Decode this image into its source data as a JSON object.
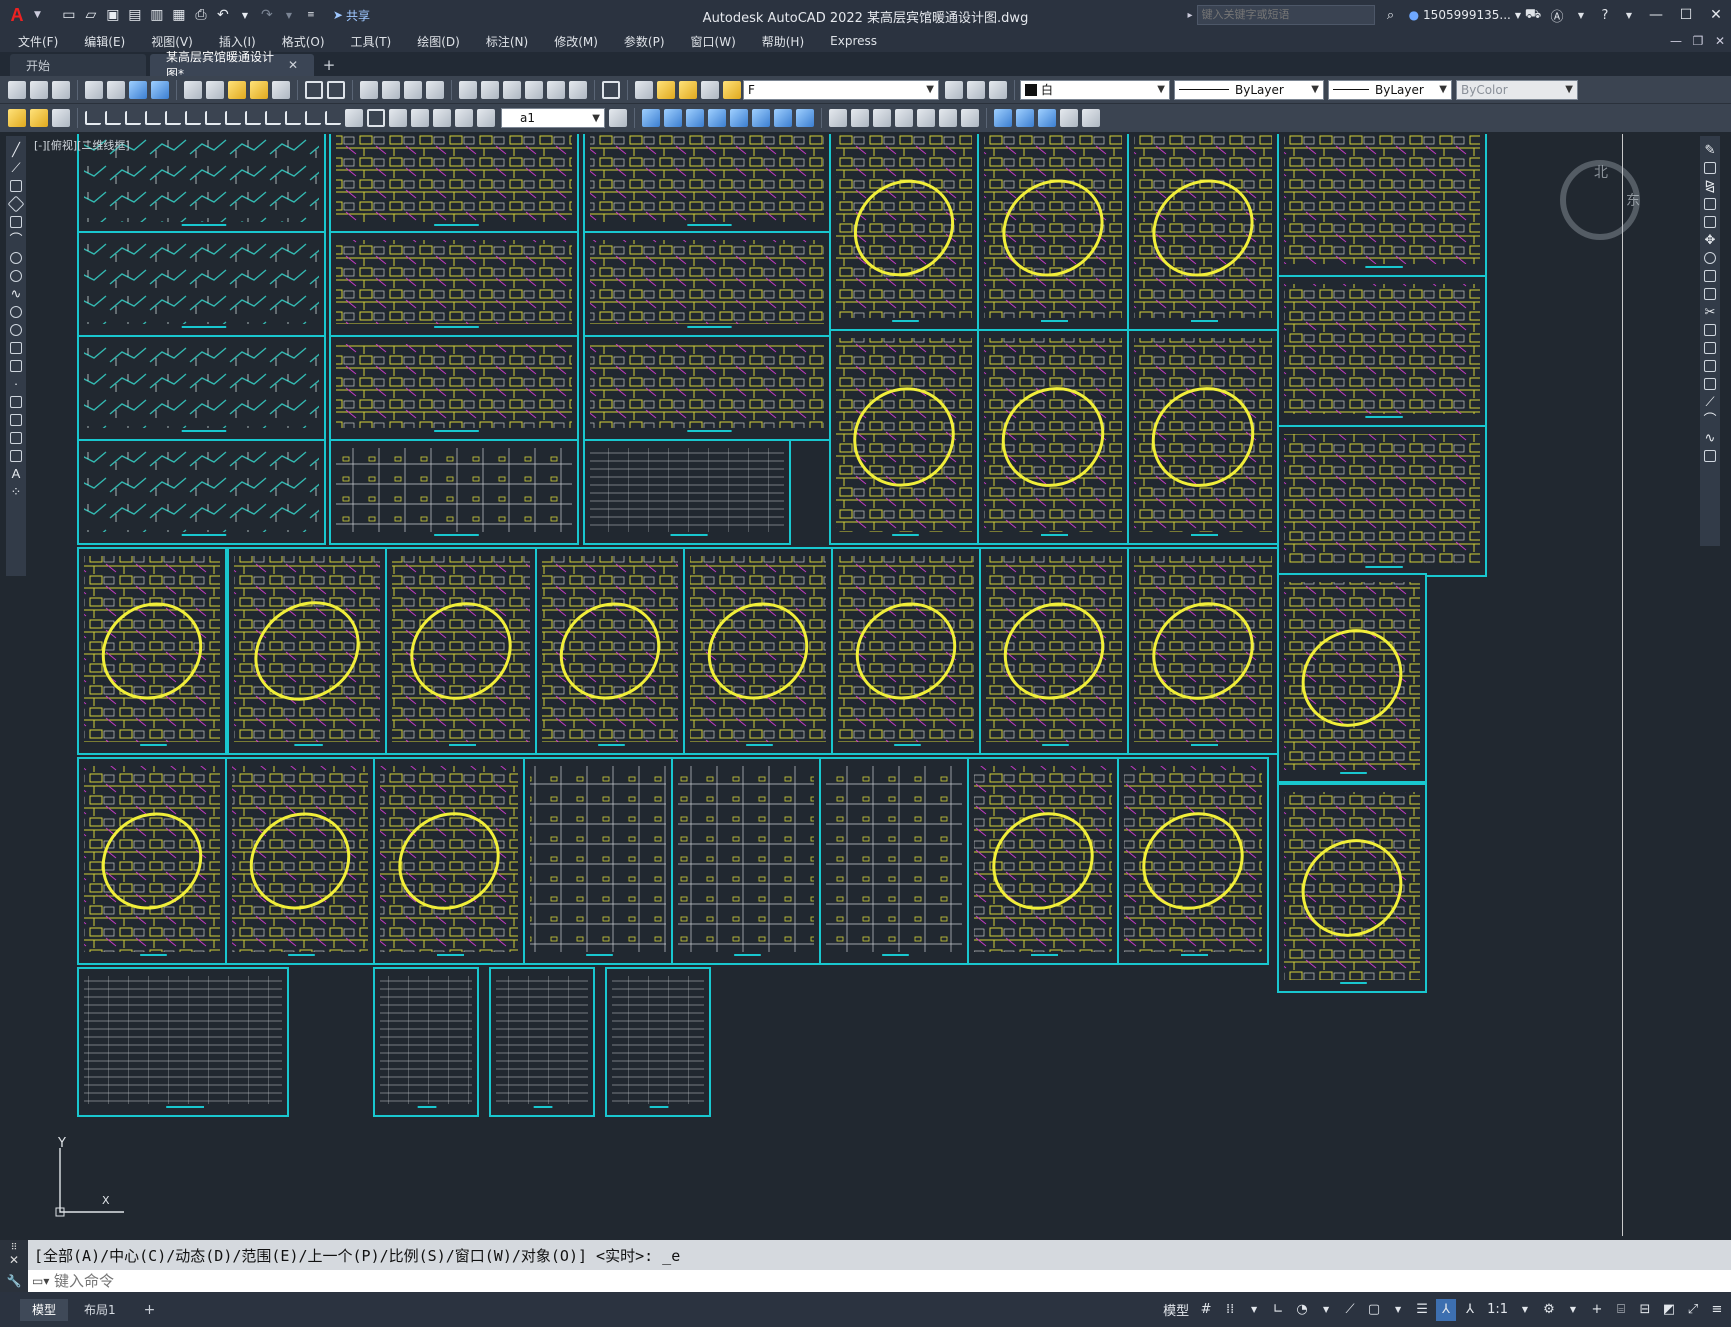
{
  "app": {
    "logo_letter": "A",
    "window_title": "Autodesk AutoCAD 2022    某高层宾馆暖通设计图.dwg",
    "share_label": "共享",
    "search_placeholder": "键入关键字或短语",
    "user_name": "1505999135...",
    "accent": "#19c7cf"
  },
  "menu": [
    "文件(F)",
    "编辑(E)",
    "视图(V)",
    "插入(I)",
    "格式(O)",
    "工具(T)",
    "绘图(D)",
    "标注(N)",
    "修改(M)",
    "参数(P)",
    "窗口(W)",
    "帮助(H)",
    "Express"
  ],
  "tabs": [
    {
      "label": "开始",
      "active": false
    },
    {
      "label": "某高层宾馆暖通设计图*",
      "active": true
    }
  ],
  "toolbar": {
    "layer_value": "F",
    "color_value": "白",
    "linetype_value": "ByLayer",
    "lineweight_value": "ByLayer",
    "plotstyle_value": "ByColor",
    "dimstyle_value": "a1"
  },
  "viewport_label": "[-][俯视][二维线框]",
  "compass": {
    "north": "北",
    "east": "东"
  },
  "ucs": {
    "y_label": "Y",
    "x_label": "X"
  },
  "command": {
    "history": "[全部(A)/中心(C)/动态(D)/范围(E)/上一个(P)/比例(S)/窗口(W)/对象(O)] <实时>: _e",
    "placeholder": "键入命令"
  },
  "status": {
    "layout_tabs": [
      "模型",
      "布局1"
    ],
    "model_label": "模型",
    "scale_label": "1:1"
  }
}
